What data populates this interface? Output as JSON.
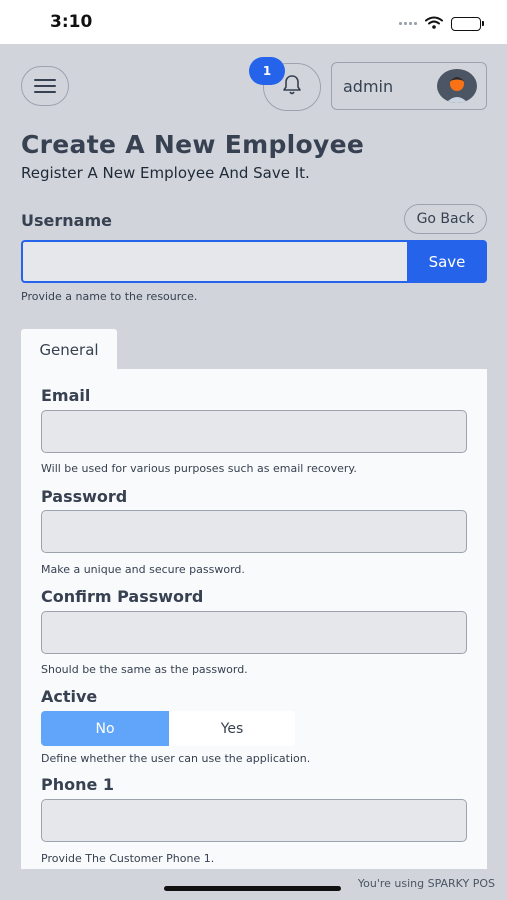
{
  "status_bar": {
    "time": "3:10"
  },
  "header": {
    "notification_count": "1",
    "username": "admin"
  },
  "page": {
    "title": "Create A New Employee",
    "subtitle": "Register A New Employee And Save It."
  },
  "username_field": {
    "label": "Username",
    "value": "",
    "hint": "Provide a name to the resource."
  },
  "actions": {
    "go_back_label": "Go Back",
    "save_label": "Save"
  },
  "tabs": [
    {
      "label": "General",
      "active": true
    }
  ],
  "form": {
    "email": {
      "label": "Email",
      "value": "",
      "hint": "Will be used for various purposes such as email recovery."
    },
    "password": {
      "label": "Password",
      "value": "",
      "hint": "Make a unique and secure password."
    },
    "confirm_password": {
      "label": "Confirm Password",
      "value": "",
      "hint": "Should be the same as the password."
    },
    "active": {
      "label": "Active",
      "options": [
        "No",
        "Yes"
      ],
      "selected": "No",
      "hint": "Define whether the user can use the application."
    },
    "phone1": {
      "label": "Phone 1",
      "value": "",
      "hint": "Provide The Customer Phone 1."
    }
  },
  "footer": {
    "note": "You're using SPARKY POS"
  },
  "colors": {
    "accent": "#2563eb",
    "toggle_selected": "#60a5fa",
    "background": "#d1d5db",
    "panel": "#f9fafb",
    "input_fill": "#e5e7eb"
  },
  "icons": [
    "menu-icon",
    "bell-icon",
    "avatar-icon",
    "signal-icon",
    "wifi-icon",
    "battery-icon"
  ]
}
